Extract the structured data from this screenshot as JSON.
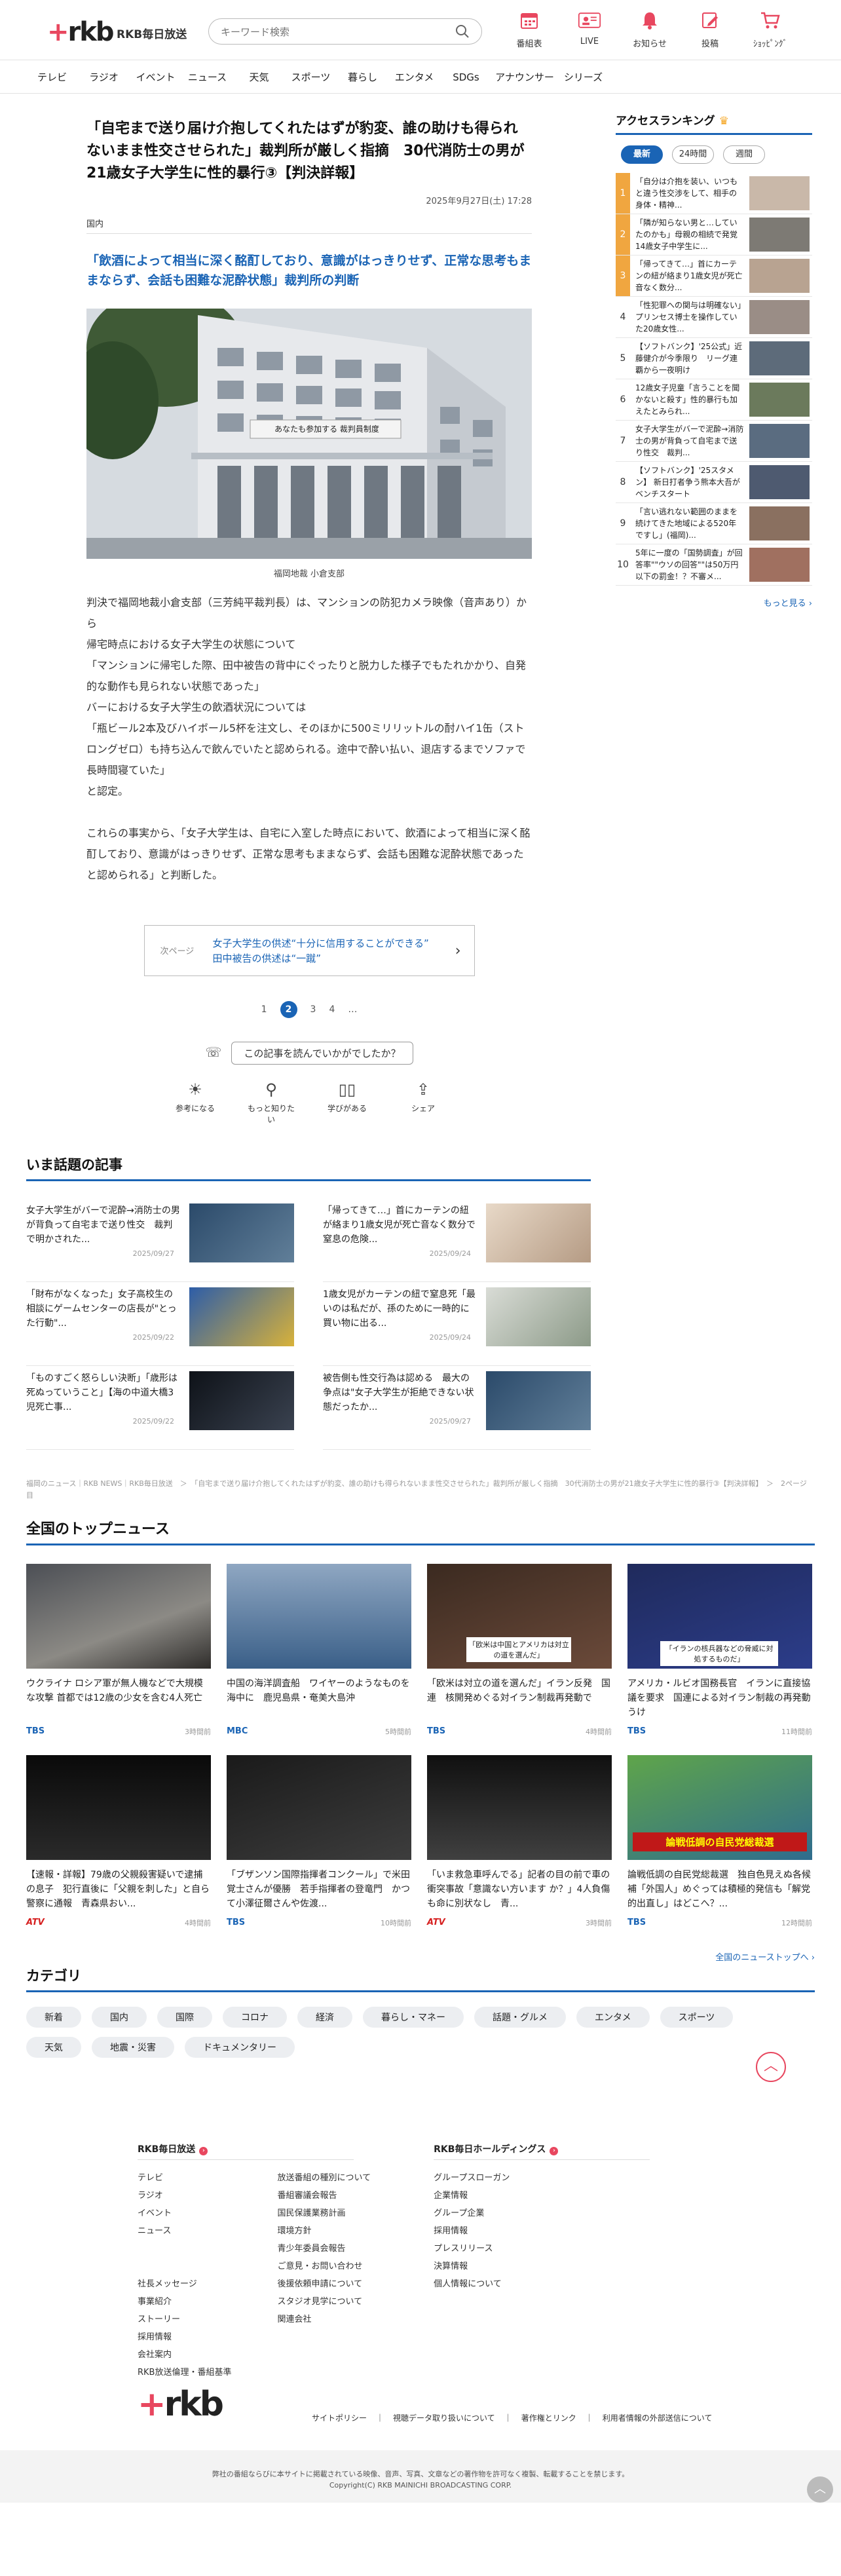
{
  "header": {
    "brand": "RKB毎日放送",
    "search_placeholder": "キーワード検索",
    "nav": [
      {
        "label": "番組表",
        "icon": "calendar-icon"
      },
      {
        "label": "LIVE",
        "icon": "live-icon"
      },
      {
        "label": "お知らせ",
        "icon": "bell-icon"
      },
      {
        "label": "投稿",
        "icon": "post-icon"
      },
      {
        "label": "ｼｮｯﾋﾟﾝｸﾞ",
        "icon": "cart-icon"
      }
    ]
  },
  "gnav": [
    "テレビ",
    "ラジオ",
    "イベント",
    "ニュース",
    "天気",
    "スポーツ",
    "暮らし",
    "エンタメ",
    "SDGs",
    "アナウンサー",
    "シリーズ"
  ],
  "article": {
    "title": "「自宅まで送り届け介抱してくれたはずが豹変、誰の助けも得られないまま性交させられた」裁判所が厳しく指摘　30代消防士の男が21歳女子大学生に性的暴行③【判決詳報】",
    "date": "2025年9月27日(土) 17:28",
    "category": "国内",
    "subhead": "「飲酒によって相当に深く酩酊しており、意識がはっきりせず、正常な思考もままならず、会話も困難な泥酔状態」裁判所の判断",
    "photo_sign": "あなたも参加する 裁判員制度",
    "caption": "福岡地裁 小倉支部",
    "body": [
      "判決で福岡地裁小倉支部（三芳純平裁判長）は、マンションの防犯カメラ映像（音声あり）から",
      "帰宅時点における女子大学生の状態について",
      "「マンションに帰宅した際、田中被告の背中にぐったりと脱力した様子でもたれかかり、自発的な動作も見られない状態であった」",
      "バーにおける女子大学生の飲酒状況については",
      "「瓶ビール2本及びハイボール5杯を注文し、そのほかに500ミリリットルの酎ハイ1缶（ストロングゼロ）も持ち込んで飲んでいたと認められる。途中で酔い払い、退店するまでソファで長時間寝ていた」",
      "と認定。",
      "",
      "これらの事実から、「女子大学生は、自宅に入室した時点において、飲酒によって相当に深く酩酊しており、意識がはっきりせず、正常な思考もままならず、会話も困難な泥酔状態であったと認められる」と判断した。"
    ],
    "next_label": "次ページ",
    "next_title": "女子大学生の供述“十分に信用することができる”　田中被告の供述は“一蹴”",
    "pages": [
      "1",
      "2",
      "3",
      "4",
      "…"
    ],
    "current_page": "2",
    "feedback_q": "この記事を読んでいかがでしたか？",
    "reactions": [
      {
        "label": "参考になる",
        "icon": "lightbulb-icon"
      },
      {
        "label": "もっと知りたい",
        "icon": "magnifier-icon"
      },
      {
        "label": "学びがある",
        "icon": "book-icon"
      },
      {
        "label": "シェア",
        "icon": "share-icon"
      }
    ]
  },
  "ranking": {
    "title": "アクセスランキング",
    "tabs": [
      "最新",
      "24時間",
      "週間"
    ],
    "active_tab": "最新",
    "items": [
      "「自分は介抱を装い、いつもと違う性交渉をして、相手の身体・精神...",
      "「隣が知らない男と…していたのかも」母親の相続で発覚 14歳女子中学生に...",
      "「帰ってきて…」首にカーテンの紐が絡まり1歳女児が死亡音なく数分...",
      "「性犯罪への関与は明確ない」プリンセス博士を操作していた20歳女性...",
      "【ソフトバンク】'25公式」近藤健介が今季限り　リーグ連覇から一夜明け",
      "12歳女子児童「言うことを聞かないと殺す」性的暴行も加えたとみられ...",
      "女子大学生がバーで泥酔→消防士の男が背負って自宅まで送り性交　裁判...",
      "【ソフトバンク】'25スタメン】 新日打者争う熊本大吾がベンチスタート",
      "「言い逃れない範囲のままを続けてきた地域による520年ですし」(福岡)...",
      "5年に一度の「国勢調査」が回答率\"\"ウソの回答\"\"は50万円以下の罰金！？不審メ..."
    ],
    "more": "もっと見る"
  },
  "hot": {
    "title": "いま話題の記事",
    "items": [
      {
        "text": "女子大学生がバーで泥酔→消防士の男が背負って自宅まで送り性交　裁判で明かされた...",
        "date": "2025/09/27"
      },
      {
        "text": "「帰ってきて…」首にカーテンの紐が絡まり1歳女児が死亡音なく数分で窒息の危険...",
        "date": "2025/09/24"
      },
      {
        "text": "「財布がなくなった」女子高校生の相談にゲームセンターの店長が\"とった行動\"...",
        "date": "2025/09/22"
      },
      {
        "text": "1歳女児がカーテンの紐で窒息死「最いのは私だが、孫のために一時的に買い物に出る...",
        "date": "2025/09/24"
      },
      {
        "text": "「ものすごく怒らしい決断」「歳形は死ぬっていうこと」【海の中道大橋3児死亡事...",
        "date": "2025/09/22"
      },
      {
        "text": "被告側も性交行為は認める　最大の争点は\"女子大学生が拒絶できない状態だったか...",
        "date": "2025/09/27"
      }
    ]
  },
  "breadcrumb": "福岡のニュース｜RKB NEWS｜RKB毎日放送　＞　「自宅まで送り届け介抱してくれたはずが豹変、誰の助けも得られないまま性交させられた」裁判所が厳しく指摘　30代消防士の男が21歳女子大学生に性的暴行③【判決詳報】　＞　2ページ目",
  "topnews": {
    "title": "全国のトップニュース",
    "more": "全国のニューストップへ",
    "items": [
      {
        "text": "ウクライナ ロシア軍が無人機などで大規模な攻撃 首都では12歳の少女を含む4人死亡",
        "src": "TBS",
        "time": "3時間前",
        "cls": ""
      },
      {
        "text": "中国の海洋調査船　ワイヤーのようなものを海中に　鹿児島県・奄美大島沖",
        "src": "MBC",
        "time": "5時間前",
        "cls": "mbc"
      },
      {
        "text": "「欧米は対立の道を選んだ」イラン反発　国連　核開発めぐる対イラン制裁再発動で",
        "src": "TBS",
        "time": "4時間前",
        "cls": ""
      },
      {
        "text": "アメリカ・ルビオ国務長官　イランに直接協議を要求　国連による対イラン制裁の再発動うけ",
        "src": "TBS",
        "time": "11時間前",
        "cls": ""
      },
      {
        "text": "【速報・詳報】79歳の父親殺害疑いで逮捕の息子　犯行直後に「父親を刺した」と自ら警察に通報　青森県おい...",
        "src": "ATV",
        "time": "4時間前",
        "cls": "atv"
      },
      {
        "text": "「ブザンソン国際指揮者コンクール」で米田覚士さんが優勝　若手指揮者の登竜門　かつて小澤征爾さんや佐渡...",
        "src": "TBS",
        "time": "10時間前",
        "cls": ""
      },
      {
        "text": "「いま救急車呼んでる」記者の目の前で車の衝突事故「意識ない方います か？」4人負傷も命に別状なし　青...",
        "src": "ATV",
        "time": "3時間前",
        "cls": "atv"
      },
      {
        "text": "論戦低調の自民党総裁選　独自色見えぬ各候補「外国人」めぐっては積極的発信も「解党的出直し」はどこへ？...",
        "src": "TBS",
        "time": "12時間前",
        "cls": ""
      }
    ],
    "img_captions": [
      "",
      "",
      "「欧米は中国とアメリカは対立の道を選んだ」",
      "「イランの核兵器などの脅威に対処するものだ」",
      "",
      "",
      "",
      "論戦低調の自民党総裁選"
    ]
  },
  "categories": {
    "title": "カテゴリ",
    "items": [
      "新着",
      "国内",
      "国際",
      "コロナ",
      "経済",
      "暮らし・マネー",
      "話題・グルメ",
      "エンタメ",
      "スポーツ",
      "天気",
      "地震・災害",
      "ドキュメンタリー"
    ]
  },
  "footer": {
    "col1": {
      "title": "RKB毎日放送",
      "a": [
        "テレビ",
        "ラジオ",
        "イベント",
        "ニュース",
        "",
        "",
        "社長メッセージ",
        "事業紹介",
        "ストーリー",
        "採用情報",
        "会社案内",
        "RKB放送倫理・番組基準"
      ],
      "b": [
        "放送番組の種別について",
        "番組審議会報告",
        "国民保護業務計画",
        "環境方針",
        "青少年委員会報告",
        "ご意見・お問い合わせ",
        "後援依頼申請について",
        "スタジオ見学について",
        "関連会社"
      ]
    },
    "col2": {
      "title": "RKB毎日ホールディングス",
      "a": [
        "グループスローガン",
        "企業情報",
        "グループ企業",
        "採用情報",
        "プレスリリース",
        "決算情報",
        "個人情報について"
      ]
    },
    "legal": [
      "サイトポリシー",
      "｜",
      "視聴データ取り扱いについて",
      "｜",
      "著作権とリンク",
      "｜",
      "利用者情報の外部送信について"
    ],
    "copy1": "弊社の番組ならびに本サイトに掲載されている映像、音声、写真、文章などの著作物を許可なく複製、転載することを禁じます。",
    "copy2": "Copyright(C) RKB MAINICHI BROADCASTING CORP."
  },
  "colors": {
    "accent": "#1a64b5",
    "brand": "#e8475f",
    "rank_top": "#f0a640"
  }
}
